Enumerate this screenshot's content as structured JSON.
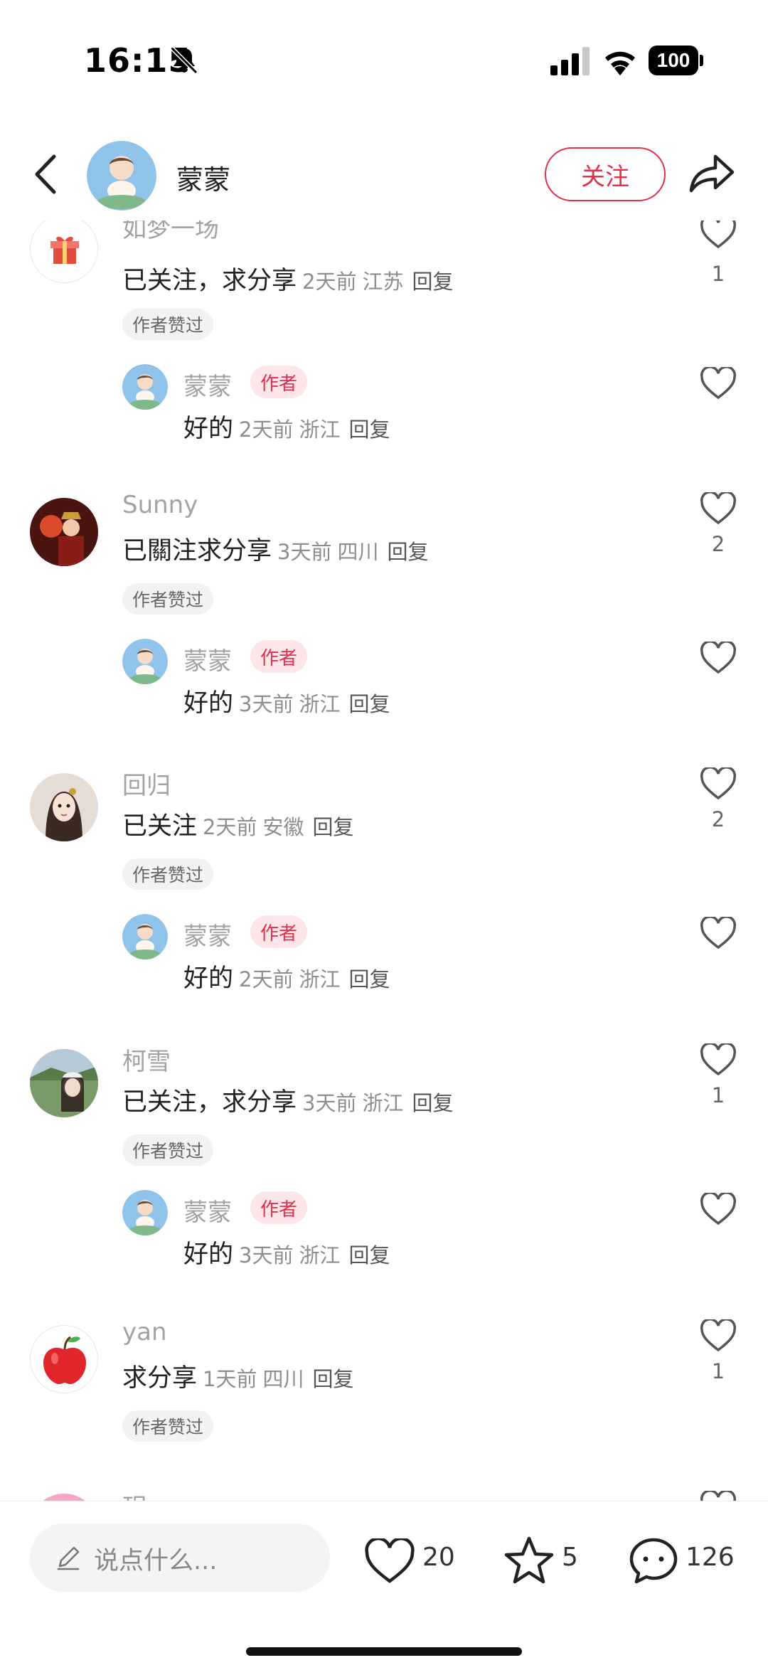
{
  "status_bar": {
    "time": "16:15",
    "battery": "100"
  },
  "header": {
    "name": "蒙蒙",
    "follow_label": "关注"
  },
  "labels": {
    "liked_by_author": "作者赞过",
    "author": "作者",
    "reply": "回复"
  },
  "comments": [
    {
      "user": "如梦一场",
      "text": "已关注，求分享",
      "time": "2天前",
      "location": "江苏",
      "likes": "1",
      "avatar_icon": "gift-icon",
      "reply": {
        "user": "蒙蒙",
        "text": "好的",
        "time": "2天前",
        "location": "浙江"
      }
    },
    {
      "user": "Sunny",
      "text": "已關注求分享",
      "time": "3天前",
      "location": "四川",
      "likes": "2",
      "reply": {
        "user": "蒙蒙",
        "text": "好的",
        "time": "3天前",
        "location": "浙江"
      }
    },
    {
      "user": "回归",
      "text": "已关注",
      "time": "2天前",
      "location": "安徽",
      "likes": "2",
      "reply": {
        "user": "蒙蒙",
        "text": "好的",
        "time": "2天前",
        "location": "浙江"
      }
    },
    {
      "user": "柯雪",
      "text": "已关注，求分享",
      "time": "3天前",
      "location": "浙江",
      "likes": "1",
      "reply": {
        "user": "蒙蒙",
        "text": "好的",
        "time": "3天前",
        "location": "浙江"
      }
    },
    {
      "user": "yan",
      "text": "求分享",
      "time": "1天前",
      "location": "四川",
      "likes": "1",
      "avatar_icon": "apple-icon"
    },
    {
      "user": "玥"
    }
  ],
  "bottom_bar": {
    "input_placeholder": "说点什么...",
    "likes": "20",
    "stars": "5",
    "comments": "126"
  },
  "colors": {
    "accent": "#e0304c",
    "author_tag_bg": "#fde6ea"
  }
}
